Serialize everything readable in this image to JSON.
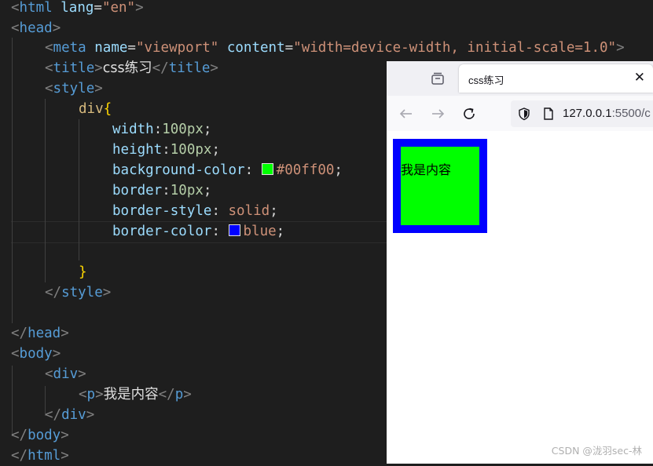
{
  "editor": {
    "html_tag": "html",
    "lang_attr": "lang",
    "lang_value": "\"en\"",
    "head_tag": "head",
    "meta_tag": "meta",
    "name_attr": "name",
    "name_value": "\"viewport\"",
    "content_attr": "content",
    "content_value": "\"width=device-width, initial-scale=1.0\"",
    "title_tag": "title",
    "title_text": "css练习",
    "style_tag": "style",
    "selector": "div",
    "width_prop": "width",
    "width_value": "100px",
    "height_prop": "height",
    "height_value": "100px",
    "bg_prop": "background-color",
    "bg_value": "#00ff00",
    "bg_swatch_color": "#00ff00",
    "border_prop": "border",
    "border_value": "10px",
    "border_style_prop": "border-style",
    "border_style_value": "solid",
    "border_color_prop": "border-color",
    "border_color_value": "blue",
    "border_swatch_color": "#0000ff",
    "body_tag": "body",
    "div_tag": "div",
    "p_tag": "p",
    "p_text": "我是内容"
  },
  "browser": {
    "tab_title": "css练习",
    "tab_close": "✕",
    "url_host": "127.0.0.1",
    "url_rest": ":5500/c",
    "content_text": "我是内容"
  },
  "watermark": "CSDN @泷羽sec-林"
}
